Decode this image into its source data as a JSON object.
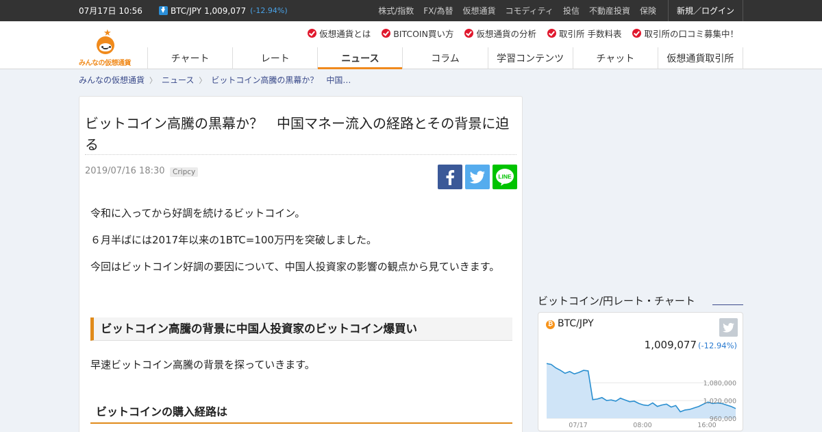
{
  "topbar": {
    "datetime": "07月17日 10:56",
    "pair": "BTC/JPY",
    "price": "1,009,077",
    "change": "(-12.94%)",
    "links": [
      "株式/指数",
      "FX/為替",
      "仮想通貨",
      "コモディティ",
      "投信",
      "不動産投資",
      "保険"
    ],
    "login": "新規／ログイン"
  },
  "logo": {
    "text": "みんなの仮想通貨"
  },
  "sublinks": [
    "仮想通貨とは",
    "BITCOIN買い方",
    "仮想通貨の分析",
    "取引所 手数料表",
    "取引所の口コミ募集中！"
  ],
  "nav": {
    "tabs": [
      "チャート",
      "レート",
      "ニュース",
      "コラム",
      "学習コンテンツ",
      "チャット",
      "仮想通貨取引所"
    ],
    "active": "ニュース"
  },
  "breadcrumb": [
    "みんなの仮想通貨",
    "ニュース",
    "ビットコイン高騰の黒幕か？　中国…"
  ],
  "article": {
    "title": "ビットコイン高騰の黒幕か？　中国マネー流入の経路とその背景に迫る",
    "date": "2019/07/16 18:30",
    "tag": "Cripcy",
    "paragraphs": [
      "令和に入ってから好調を続けるビットコイン。",
      "６月半ばには2017年以来の1BTC=100万円を突破しました。",
      "今回はビットコイン好調の要因について、中国人投資家の影響の観点から見ていきます。"
    ],
    "heading2": "ビットコイン高騰の背景に中国人投資家のビットコイン爆買い",
    "paragraph4": "早速ビットコイン高騰の背景を探っていきます。",
    "heading3": "ビットコインの購入経路は"
  },
  "share": {
    "facebook": "facebook-icon",
    "twitter": "twitter-icon",
    "line": "LINE"
  },
  "widget": {
    "title": "ビットコイン/円レート・チャート",
    "pair": "BTC/JPY",
    "price": "1,009,077",
    "change": "(-12.94%)",
    "coin_symbol": "₿"
  },
  "chart_data": {
    "type": "area",
    "y_ticks": [
      "1,080,000",
      "1,020,000",
      "960,000"
    ],
    "x_ticks": [
      "07/17",
      "08:00",
      "16:00"
    ],
    "ylim": [
      960000,
      1150000
    ],
    "values": [
      1145000,
      1142000,
      1130000,
      1122000,
      1112000,
      1118000,
      1110000,
      1115000,
      1122000,
      1120000,
      1023000,
      1025000,
      1030000,
      1020000,
      1022000,
      1018000,
      1028000,
      1022000,
      1016000,
      1018000,
      1010000,
      1005000,
      1003000,
      1012000,
      1000000,
      1005000,
      1008000,
      998000,
      1003000,
      982000,
      988000,
      990000,
      995000,
      1000000,
      1008000,
      1015000,
      1010000,
      1012000,
      1010000,
      1005000,
      1000000,
      993000
    ],
    "color": "#2a8fd0",
    "fill": "#cfe4f7"
  }
}
